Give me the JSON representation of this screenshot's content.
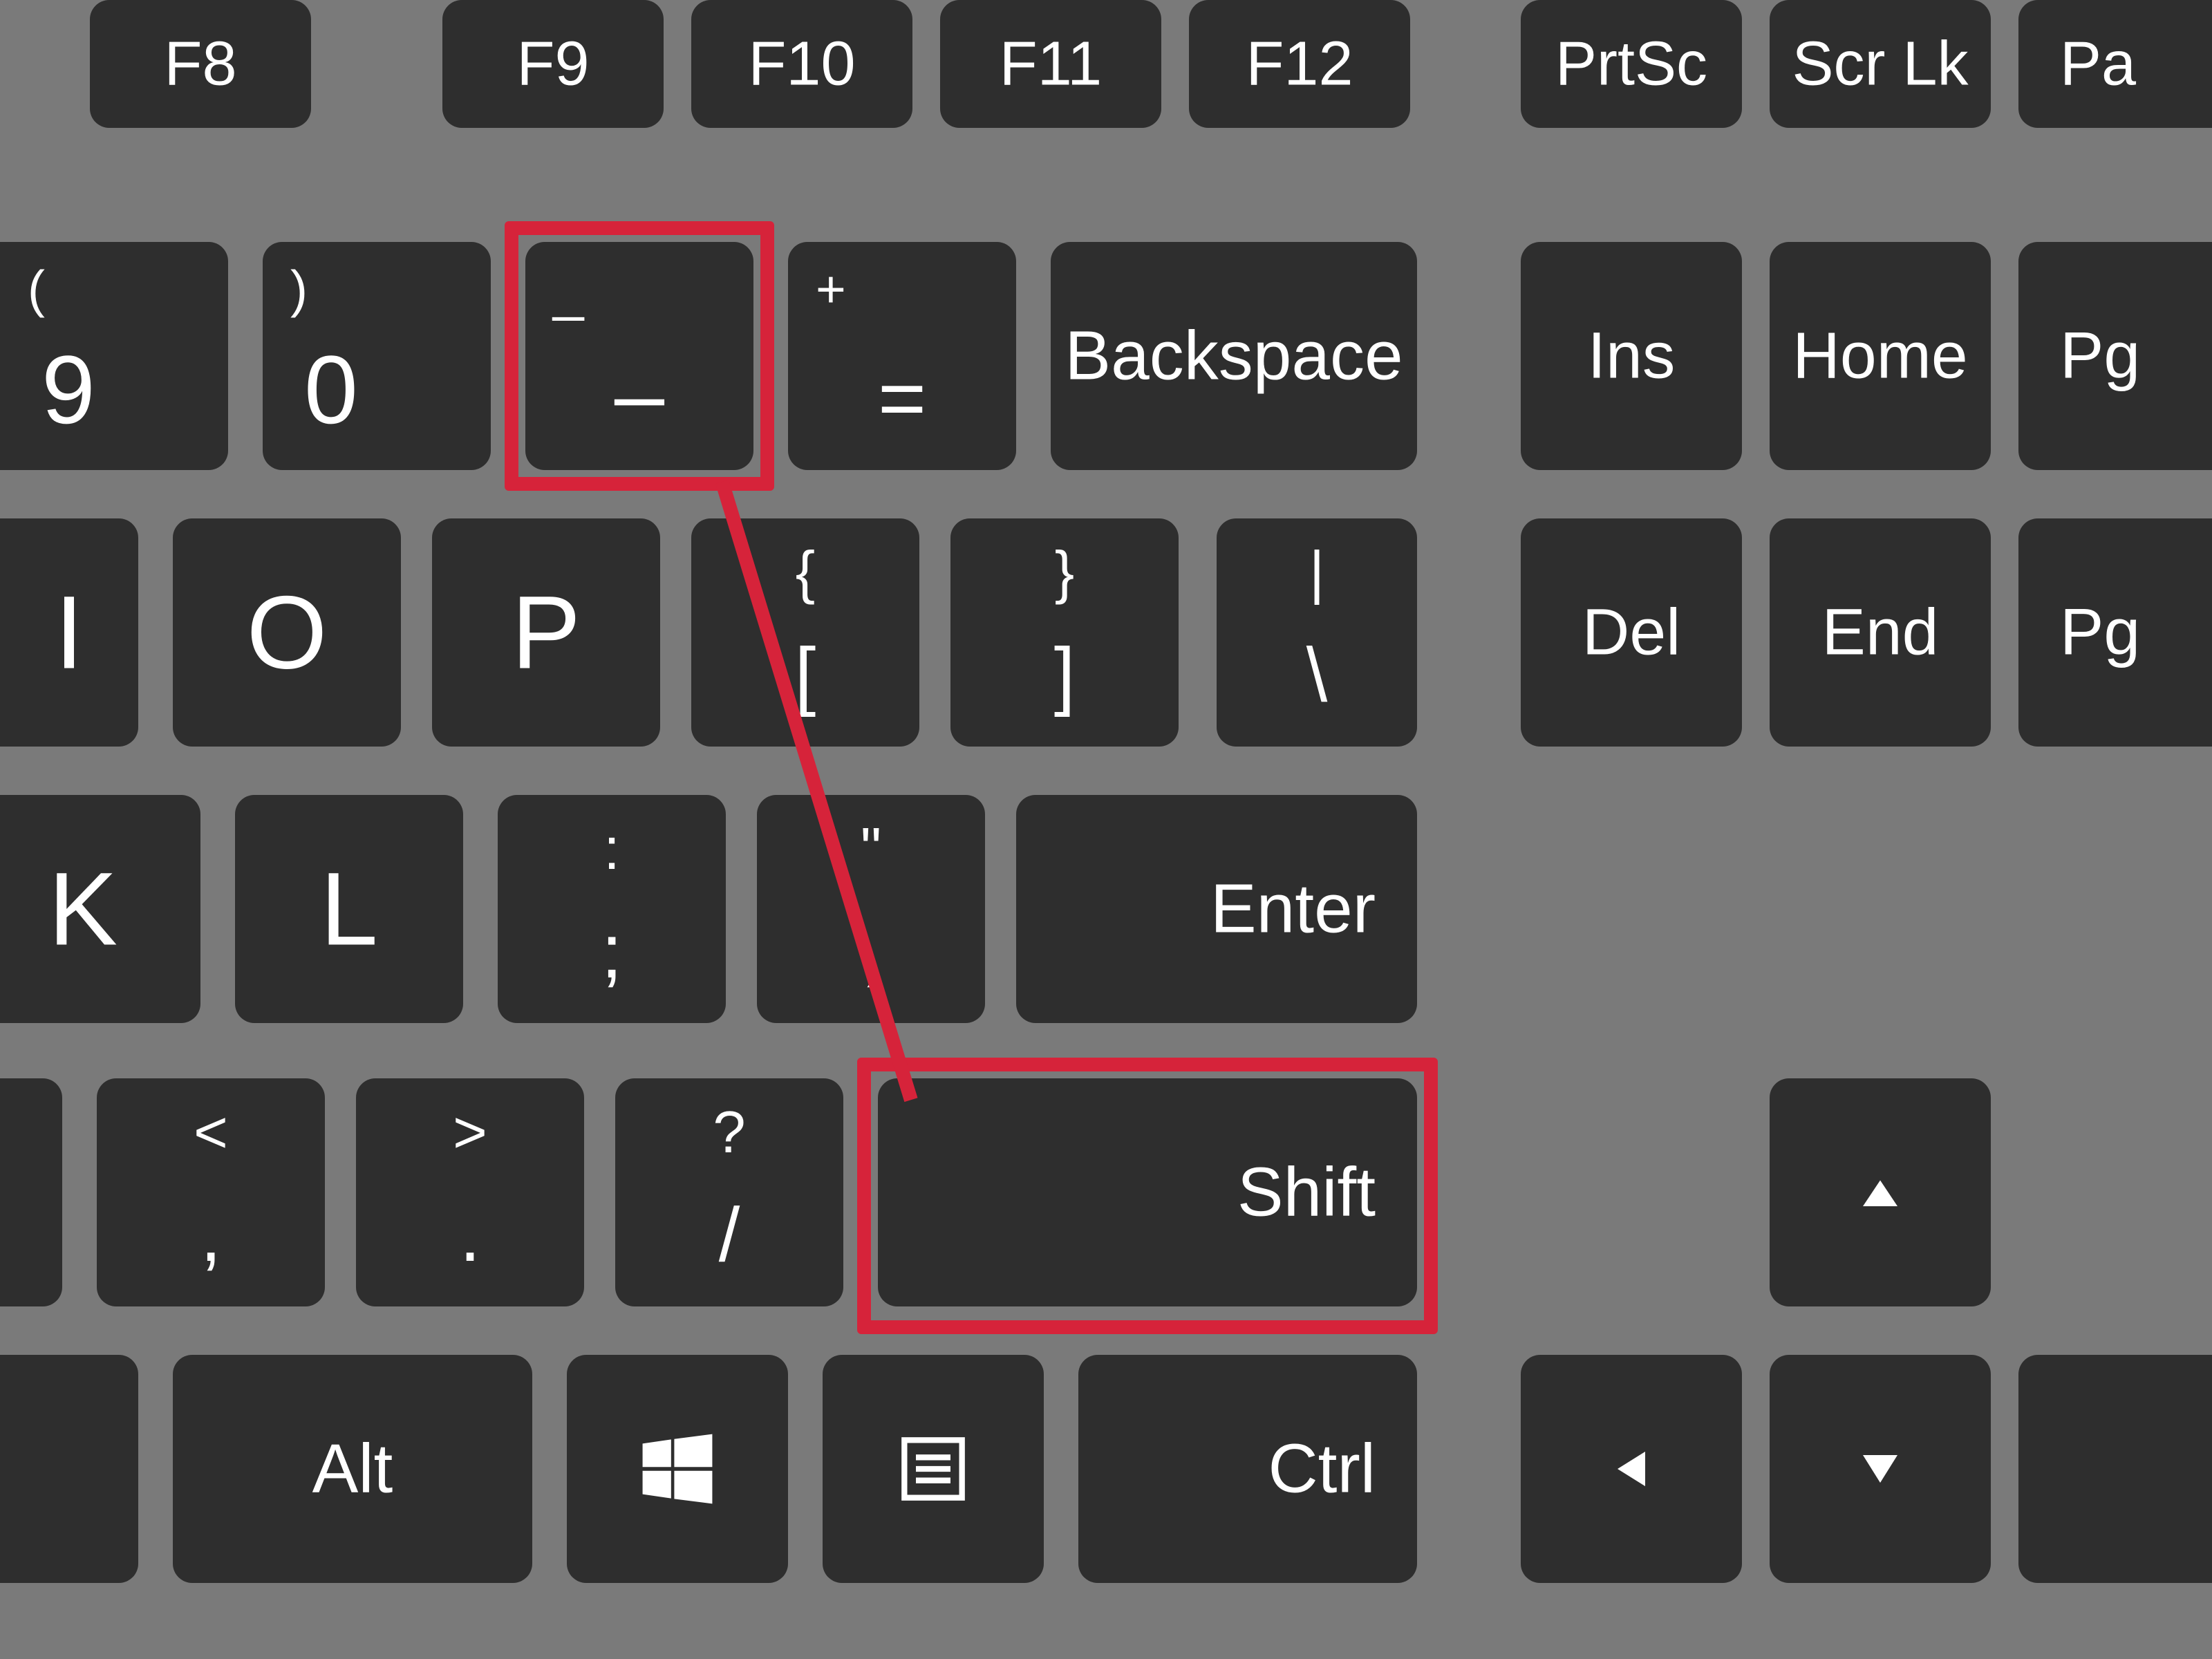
{
  "colors": {
    "background": "#7a7a7a",
    "key": "#2e2e2e",
    "text": "#ffffff",
    "highlight": "#d6233a"
  },
  "highlighted_keys": [
    "minus",
    "shift-right"
  ],
  "function_row": {
    "f8": "F8",
    "f9": "F9",
    "f10": "F10",
    "f11": "F11",
    "f12": "F12",
    "prtsc": "PrtSc",
    "scrlk": "Scr Lk",
    "pa_partial": "Pa"
  },
  "number_row": {
    "nine_shift": "(",
    "nine": "9",
    "zero_shift": ")",
    "zero": "0",
    "minus_shift": "_",
    "minus": "–",
    "equals_shift": "+",
    "equals": "=",
    "backspace": "Backspace",
    "ins": "Ins",
    "home": "Home",
    "pg_partial": "Pg"
  },
  "row1": {
    "i": "I",
    "o": "O",
    "p": "P",
    "bracket_left_shift": "{",
    "bracket_left": "[",
    "bracket_right_shift": "}",
    "bracket_right": "]",
    "backslash_shift": "|",
    "backslash": "\\",
    "del": "Del",
    "end": "End",
    "pg_partial": "Pg"
  },
  "row2": {
    "k": "K",
    "l": "L",
    "semicolon_shift": ":",
    "semicolon": ";",
    "quote_shift": "\"",
    "quote": ",",
    "enter": "Enter"
  },
  "row3": {
    "m_partial": "",
    "comma_shift": "<",
    "comma": ",",
    "period_shift": ">",
    "period": ".",
    "slash_shift": "?",
    "slash": "/",
    "shift": "Shift",
    "arrow_up_icon": "arrow-up"
  },
  "bottom_row": {
    "alt": "Alt",
    "windows_icon": "windows",
    "menu_icon": "menu",
    "ctrl": "Ctrl",
    "arrow_left_icon": "arrow-left",
    "arrow_down_icon": "arrow-down"
  }
}
